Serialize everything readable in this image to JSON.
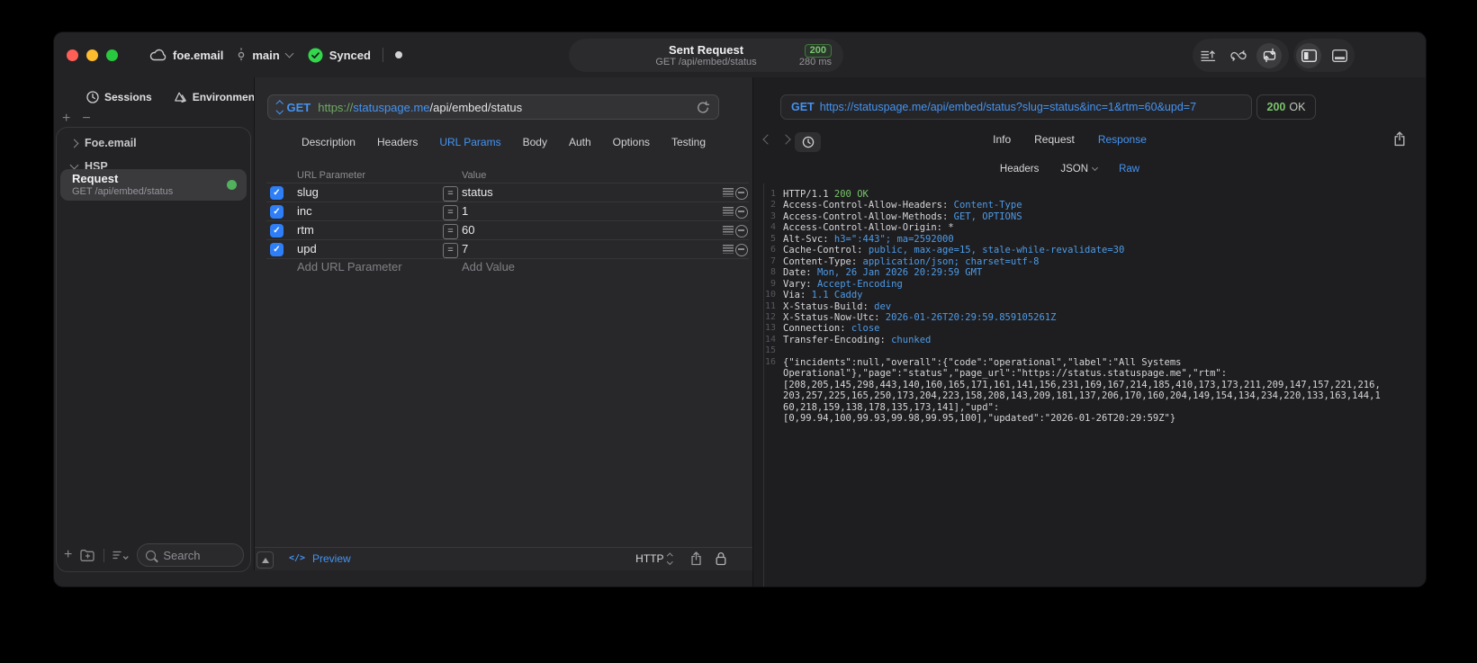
{
  "titlebar": {
    "workspace": "foe.email",
    "branch": "main",
    "sync_status": "Synced",
    "request_title": "Sent Request",
    "request_subtitle": "GET /api/embed/status",
    "status_code": "200",
    "duration": "280 ms"
  },
  "sidebar": {
    "tabs": [
      {
        "label": "Sessions"
      },
      {
        "label": "Environments"
      }
    ],
    "groups": [
      {
        "label": "Foe.email",
        "expanded": false
      },
      {
        "label": "HSP",
        "expanded": true
      }
    ],
    "request_item": {
      "title": "Request",
      "subtitle": "GET /api/embed/status"
    },
    "search_placeholder": "Search"
  },
  "request_panel": {
    "method": "GET",
    "url_scheme": "https://",
    "url_host": "statuspage.me",
    "url_path": "/api/embed/status",
    "tabs": [
      "Description",
      "Headers",
      "URL Params",
      "Body",
      "Auth",
      "Options",
      "Testing"
    ],
    "active_tab": "URL Params",
    "param_table": {
      "col_param": "URL Parameter",
      "col_value": "Value",
      "rows": [
        {
          "name": "slug",
          "value": "status",
          "enabled": true
        },
        {
          "name": "inc",
          "value": "1",
          "enabled": true
        },
        {
          "name": "rtm",
          "value": "60",
          "enabled": true
        },
        {
          "name": "upd",
          "value": "7",
          "enabled": true
        }
      ],
      "add_param": "Add URL Parameter",
      "add_value": "Add Value"
    },
    "footer": {
      "code_glyph": "</>",
      "preview": "Preview",
      "protocol": "HTTP"
    }
  },
  "response_panel": {
    "method": "GET",
    "url": "https://statuspage.me/api/embed/status?slug=status&inc=1&rtm=60&upd=7",
    "status_code": "200",
    "status_text": "OK",
    "tabs": [
      "Info",
      "Request",
      "Response"
    ],
    "active_tab": "Response",
    "subtabs": [
      "Headers",
      "JSON",
      "Raw"
    ],
    "active_subtab": "Raw",
    "body_lines": [
      {
        "n": "1",
        "parts": [
          [
            "HTTP/1.1 ",
            "p"
          ],
          [
            "200 OK",
            "g"
          ]
        ]
      },
      {
        "n": "2",
        "parts": [
          [
            "Access-Control-Allow-Headers: ",
            "p"
          ],
          [
            "Content-Type",
            "b"
          ]
        ]
      },
      {
        "n": "3",
        "parts": [
          [
            "Access-Control-Allow-Methods: ",
            "p"
          ],
          [
            "GET, OPTIONS",
            "b"
          ]
        ]
      },
      {
        "n": "4",
        "parts": [
          [
            "Access-Control-Allow-Origin: ",
            "p"
          ],
          [
            "*",
            "p"
          ]
        ]
      },
      {
        "n": "5",
        "parts": [
          [
            "Alt-Svc: ",
            "p"
          ],
          [
            "h3=\":443\"; ma=2592000",
            "b"
          ]
        ]
      },
      {
        "n": "6",
        "parts": [
          [
            "Cache-Control: ",
            "p"
          ],
          [
            "public, max-age=15, stale-while-revalidate=30",
            "b"
          ]
        ]
      },
      {
        "n": "7",
        "parts": [
          [
            "Content-Type: ",
            "p"
          ],
          [
            "application/json; charset=utf-8",
            "b"
          ]
        ]
      },
      {
        "n": "8",
        "parts": [
          [
            "Date: ",
            "p"
          ],
          [
            "Mon, 26 Jan 2026 20:29:59 GMT",
            "b"
          ]
        ]
      },
      {
        "n": "9",
        "parts": [
          [
            "Vary: ",
            "p"
          ],
          [
            "Accept-Encoding",
            "b"
          ]
        ]
      },
      {
        "n": "10",
        "parts": [
          [
            "Via: ",
            "p"
          ],
          [
            "1.1 Caddy",
            "b"
          ]
        ]
      },
      {
        "n": "11",
        "parts": [
          [
            "X-Status-Build: ",
            "p"
          ],
          [
            "dev",
            "b"
          ]
        ]
      },
      {
        "n": "12",
        "parts": [
          [
            "X-Status-Now-Utc: ",
            "p"
          ],
          [
            "2026-01-26T20:29:59.859105261Z",
            "b"
          ]
        ]
      },
      {
        "n": "13",
        "parts": [
          [
            "Connection: ",
            "p"
          ],
          [
            "close",
            "b"
          ]
        ]
      },
      {
        "n": "14",
        "parts": [
          [
            "Transfer-Encoding: ",
            "p"
          ],
          [
            "chunked",
            "b"
          ]
        ]
      },
      {
        "n": "15",
        "parts": []
      },
      {
        "n": "16",
        "parts": [
          [
            "{\"incidents\":null,\"overall\":{\"code\":\"operational\",\"label\":\"All Systems",
            "p"
          ]
        ]
      },
      {
        "n": "",
        "parts": [
          [
            "Operational\"},\"page\":\"status\",\"page_url\":\"https://status.statuspage.me\",\"rtm\":",
            "p"
          ]
        ]
      },
      {
        "n": "",
        "parts": [
          [
            "[208,205,145,298,443,140,160,165,171,161,141,156,231,169,167,214,185,410,173,173,211,209,147,157,221,216,",
            "p"
          ]
        ]
      },
      {
        "n": "",
        "parts": [
          [
            "203,257,225,165,250,173,204,223,158,208,143,209,181,137,206,170,160,204,149,154,134,234,220,133,163,144,1",
            "p"
          ]
        ]
      },
      {
        "n": "",
        "parts": [
          [
            "60,218,159,138,178,135,173,141],\"upd\":",
            "p"
          ]
        ]
      },
      {
        "n": "",
        "parts": [
          [
            "[0,99.94,100,99.93,99.98,99.95,100],\"updated\":\"2026-01-26T20:29:59Z\"}",
            "p"
          ]
        ]
      }
    ]
  },
  "colors": {
    "accent": "#4593f0",
    "green": "#78c46a",
    "checkbox_blue": "#2e7ef7",
    "traffic_red": "#ff5f57",
    "traffic_yellow": "#febc2e",
    "traffic_green": "#29c93f",
    "synced_green": "#32d74b"
  }
}
